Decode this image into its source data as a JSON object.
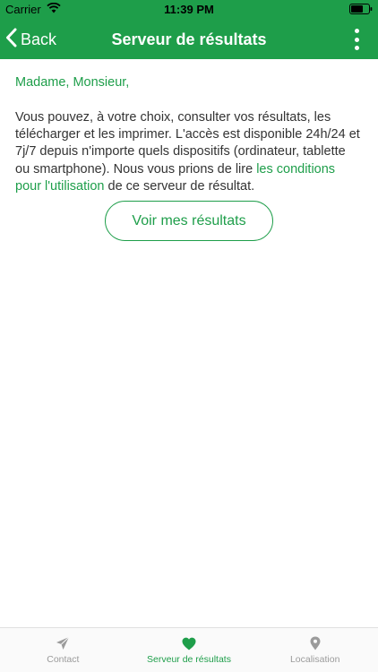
{
  "status_bar": {
    "carrier": "Carrier",
    "time": "11:39 PM"
  },
  "nav": {
    "back_label": "Back",
    "title": "Serveur de résultats"
  },
  "content": {
    "greeting": "Madame, Monsieur,",
    "paragraph_start": "Vous pouvez, à votre choix, consulter vos résultats, les télécharger et les imprimer. L'accès est disponible 24h/24 et 7j/7 depuis n'importe quels dispositifs (ordinateur, tablette ou smartphone). Nous vous prions de lire ",
    "link_text": "les conditions pour l'utilisation",
    "paragraph_end": " de ce serveur de résultat.",
    "button_label": "Voir mes résultats"
  },
  "tabs": [
    {
      "label": "Contact",
      "icon": "paper-plane-icon",
      "active": false
    },
    {
      "label": "Serveur de résultats",
      "icon": "heart-icon",
      "active": true
    },
    {
      "label": "Localisation",
      "icon": "location-pin-icon",
      "active": false
    }
  ],
  "colors": {
    "accent": "#1e9e4a",
    "tab_inactive": "#9b9b9b",
    "text": "#333333"
  }
}
